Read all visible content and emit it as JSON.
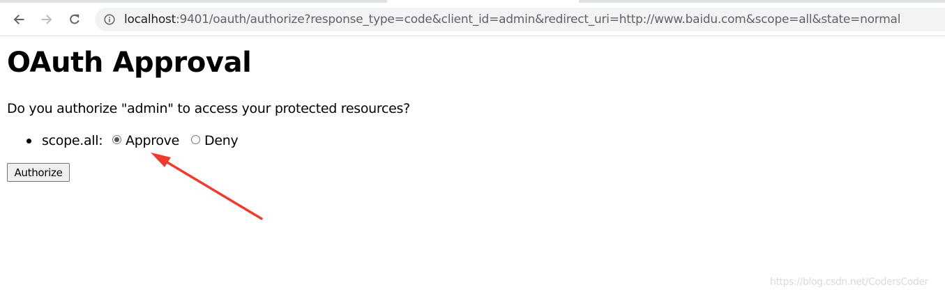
{
  "browser": {
    "url_host": "localhost",
    "url_rest": ":9401/oauth/authorize?response_type=code&client_id=admin&redirect_uri=http://www.baidu.com&scope=all&state=normal"
  },
  "page": {
    "title": "OAuth Approval",
    "question": "Do you authorize \"admin\" to access your protected resources?",
    "scopes": [
      {
        "name": "scope.all:",
        "approve_label": "Approve",
        "deny_label": "Deny",
        "selected": "Approve"
      }
    ],
    "submit_label": "Authorize"
  },
  "annotation": {
    "color": "#f03a2e"
  },
  "watermark": "https://blog.csdn.net/CodersCoder"
}
